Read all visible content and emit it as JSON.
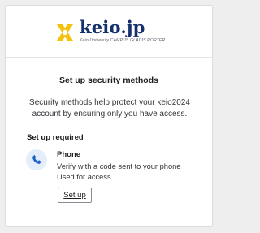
{
  "brand": {
    "name": "keio.jp",
    "subtitle": "Keio University CAMPUS GLADIS PORTER",
    "mark_colors": {
      "gold": "#f4c20d",
      "navy": "#14306c"
    }
  },
  "page": {
    "title": "Set up security methods",
    "description": "Security methods help protect your keio2024 account by ensuring only you have access."
  },
  "required_section": {
    "label": "Set up required",
    "methods": [
      {
        "icon": "phone-icon",
        "name": "Phone",
        "detail_lines": [
          "Verify with a code sent to your phone",
          "Used for access"
        ],
        "action_label": "Set up"
      }
    ]
  },
  "colors": {
    "accent": "#1a62c9",
    "icon_bg": "#e4eefb",
    "card_bg": "#ffffff",
    "page_bg": "#eeeeee"
  }
}
